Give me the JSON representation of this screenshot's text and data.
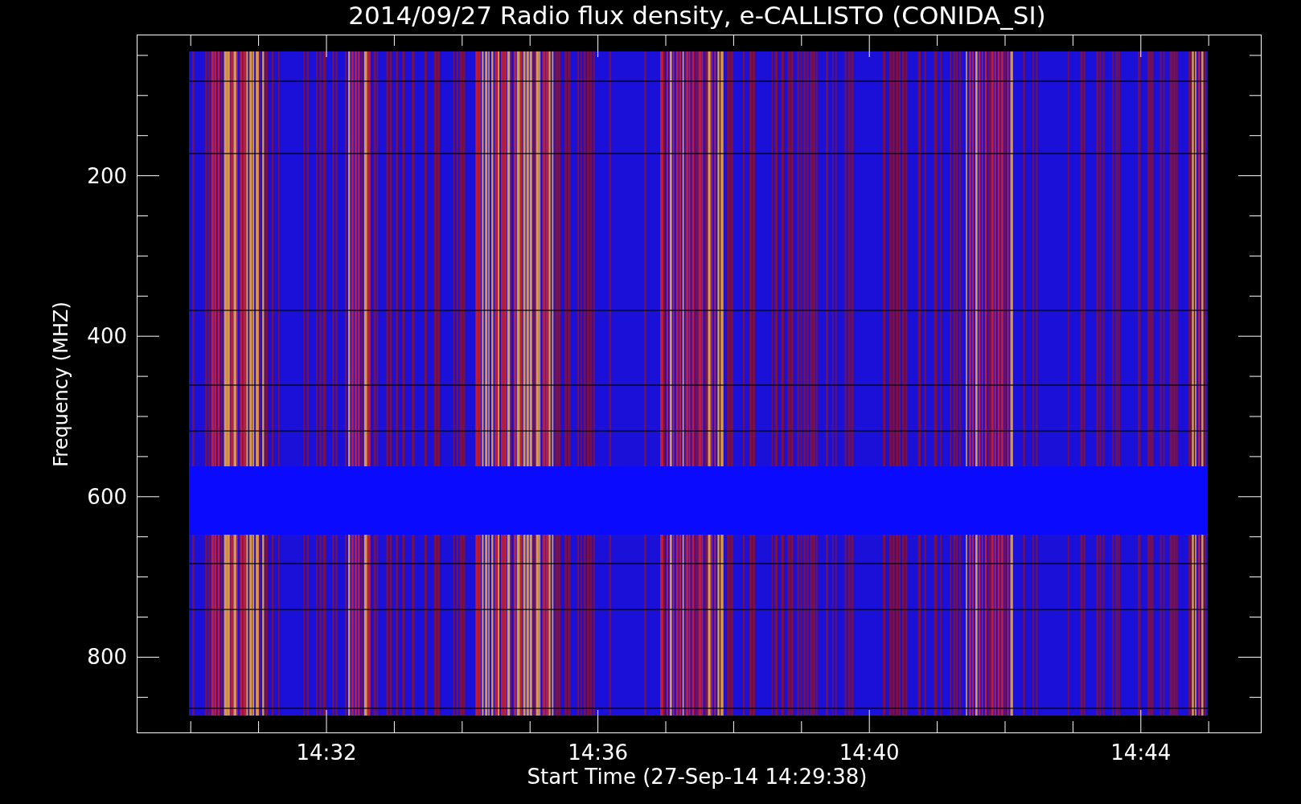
{
  "title": "2014/09/27  Radio flux density, e-CALLISTO (CONIDA_SI)",
  "y_axis": {
    "label": "Frequency (MHZ)",
    "ticks": [
      "200",
      "400",
      "600",
      "800"
    ]
  },
  "x_axis": {
    "label": "Start Time (27-Sep-14 14:29:38)",
    "ticks": [
      "14:32",
      "14:36",
      "14:40",
      "14:44"
    ]
  }
}
